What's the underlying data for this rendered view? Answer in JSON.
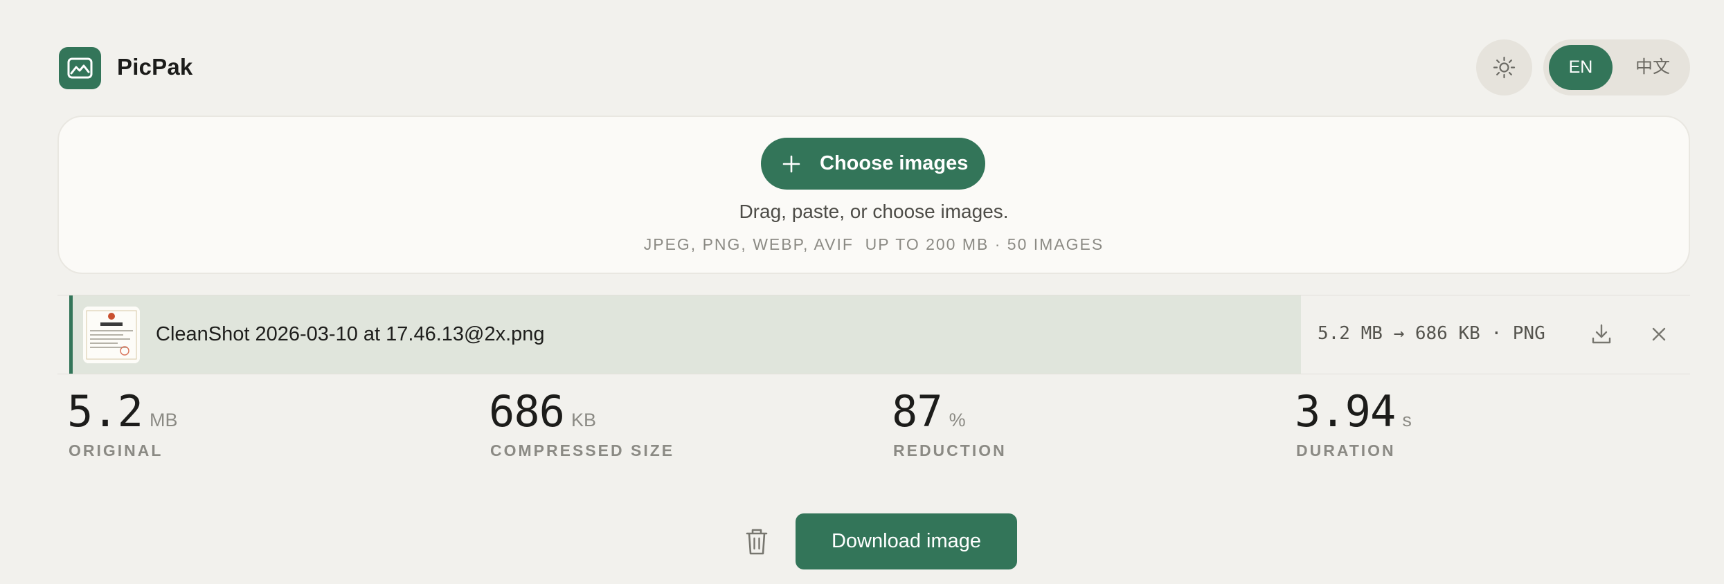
{
  "app": {
    "name": "PicPak",
    "logo_icon": "image-landscape-icon",
    "accent_color": "#337559"
  },
  "header": {
    "theme_icon": "sun-icon",
    "languages": [
      {
        "label": "EN",
        "selected": true
      },
      {
        "label": "中文",
        "selected": false
      }
    ]
  },
  "dropzone": {
    "button_label": "Choose images",
    "button_icon": "plus-icon",
    "hint": "Drag, paste, or choose images.",
    "formats": "JPEG, PNG, WEBP, AVIF  UP TO 200 MB · 50 IMAGES"
  },
  "file": {
    "name": "CleanShot 2026-03-10 at 17.46.13@2x.png",
    "stats": "5.2 MB → 686 KB · PNG",
    "progress": 0.76,
    "download_icon": "download-icon",
    "close_icon": "close-icon"
  },
  "stats": [
    {
      "value": "5.2",
      "unit": "MB",
      "label": "ORIGINAL"
    },
    {
      "value": "686",
      "unit": "KB",
      "label": "COMPRESSED SIZE"
    },
    {
      "value": "87",
      "unit": "%",
      "label": "REDUCTION"
    },
    {
      "value": "3.94",
      "unit": "s",
      "label": "DURATION"
    }
  ],
  "actions": {
    "trash_icon": "trash-icon",
    "download_label": "Download image"
  }
}
